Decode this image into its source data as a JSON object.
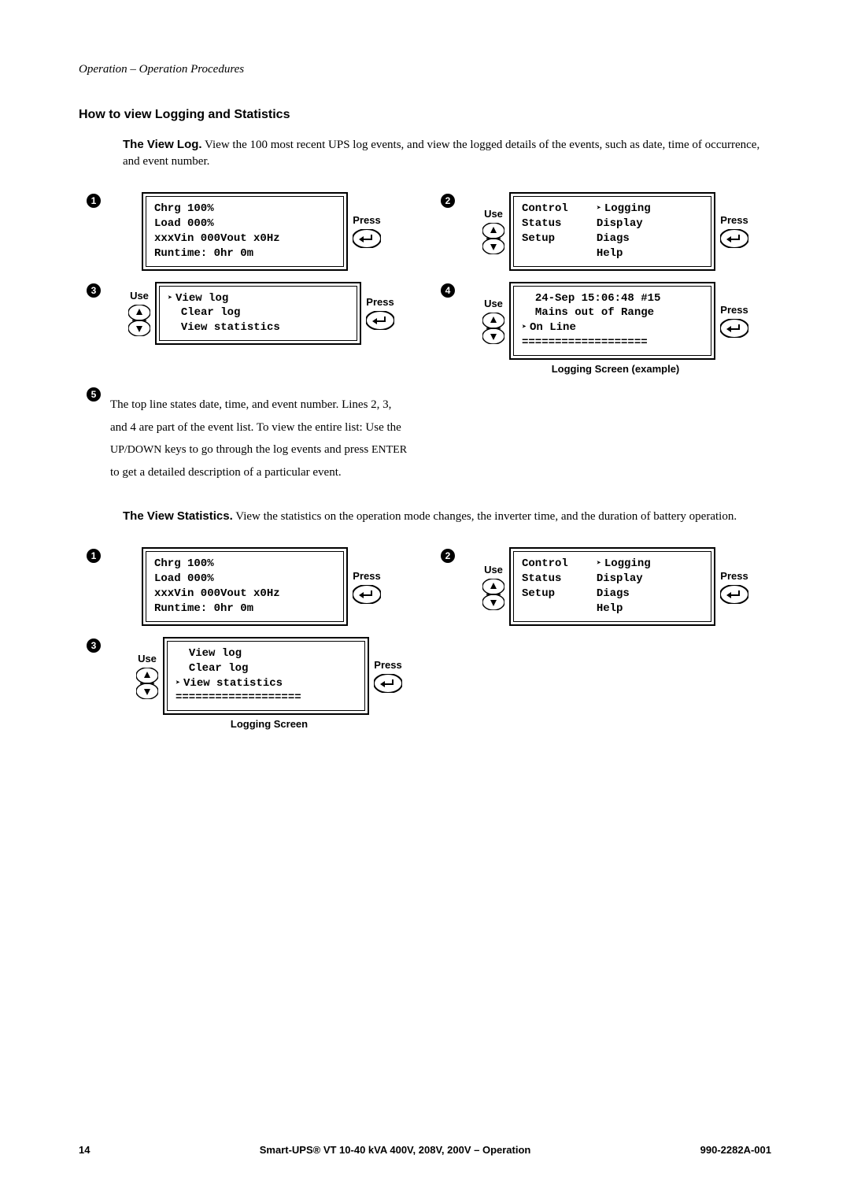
{
  "header": "Operation – Operation Procedures",
  "section_title": "How to view Logging and Statistics",
  "view_log": {
    "title": "The View Log.",
    "desc": " View the 100 most recent UPS log events, and view the logged details of the events, such as date, time of occurrence, and event number."
  },
  "labels": {
    "press": "Press",
    "use": "Use"
  },
  "log_steps": {
    "s1": {
      "line1": "Chrg 100%",
      "line2": "Load 000%",
      "line3": "xxxVin 000Vout x0Hz",
      "line4": "Runtime: 0hr 0m"
    },
    "s2": {
      "colA1": "Control",
      "colA2": "Status",
      "colA3": "Setup",
      "colB1": "Logging",
      "colB2": "Display",
      "colB3": "Diags",
      "colB4": "Help"
    },
    "s3": {
      "line1": "View log",
      "line2": "Clear log",
      "line3": "View statistics"
    },
    "s4": {
      "line1": "24-Sep 15:06:48 #15",
      "line2": "Mains out of Range",
      "line3": "On Line",
      "line4": "===================",
      "caption": "Logging Screen (example)"
    },
    "s5": {
      "a": "The top line states date, time, and event number. Lines 2, 3, and 4 are part of the event list. To view the entire list: Use the ",
      "b": "UP/DOWN",
      "c": " keys to go through the log events and press ",
      "d": "ENTER",
      "e": " to get a detailed description of a particular event."
    }
  },
  "view_stats": {
    "title": "The View Statistics.",
    "desc": " View the statistics on the operation mode changes, the inverter time, and the duration of battery operation."
  },
  "stat_steps": {
    "s1": {
      "line1": "Chrg 100%",
      "line2": "Load 000%",
      "line3": "xxxVin 000Vout x0Hz",
      "line4": "Runtime: 0hr 0m"
    },
    "s2": {
      "colA1": "Control",
      "colA2": "Status",
      "colA3": "Setup",
      "colB1": "Logging",
      "colB2": "Display",
      "colB3": "Diags",
      "colB4": "Help"
    },
    "s3": {
      "line1": "View log",
      "line2": "Clear log",
      "line3": "View statistics",
      "line4": "===================",
      "caption": "Logging Screen"
    }
  },
  "footer": {
    "page": "14",
    "center": "Smart-UPS® VT 10-40 kVA 400V, 208V, 200V – Operation",
    "right": "990-2282A-001"
  },
  "icons": {
    "up": "▲",
    "down": "▼"
  }
}
